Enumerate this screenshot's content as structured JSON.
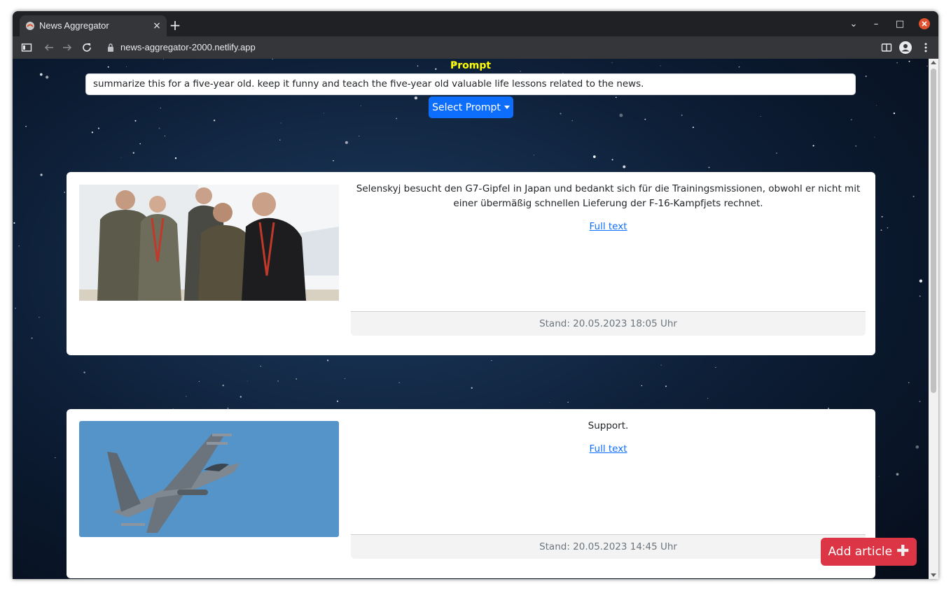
{
  "browser": {
    "tab_title": "News Aggregator",
    "tab_close": "×",
    "new_tab": "+",
    "url": "news-aggregator-2000.netlify.app",
    "window_controls": {
      "chevron": "⌄",
      "minimize": "–",
      "maximize": "□"
    }
  },
  "prompt": {
    "label": "Prompt",
    "value": "summarize this for a five-year old. keep it funny and teach the five-year old valuable life lessons related to the news.",
    "select_button": "Select Prompt"
  },
  "articles": [
    {
      "summary": "Selenskyj besucht den G7-Gipfel in Japan und bedankt sich für die Trainingsmissionen, obwohl er nicht mit einer übermäßig schnellen Lieferung der F-16-Kampfjets rechnet.",
      "link_text": "Full text",
      "footer": "Stand: 20.05.2023 18:05 Uhr",
      "image": "photo-men-in-military-clothing"
    },
    {
      "summary": "Support.",
      "link_text": "Full text",
      "footer": "Stand: 20.05.2023 14:45 Uhr",
      "image": "photo-f16-jet"
    }
  ],
  "add_button": {
    "label": "Add article",
    "icon": "plus-icon"
  },
  "colors": {
    "prompt_label": "#ffff00",
    "primary": "#0d6efd",
    "danger": "#dc3545"
  }
}
